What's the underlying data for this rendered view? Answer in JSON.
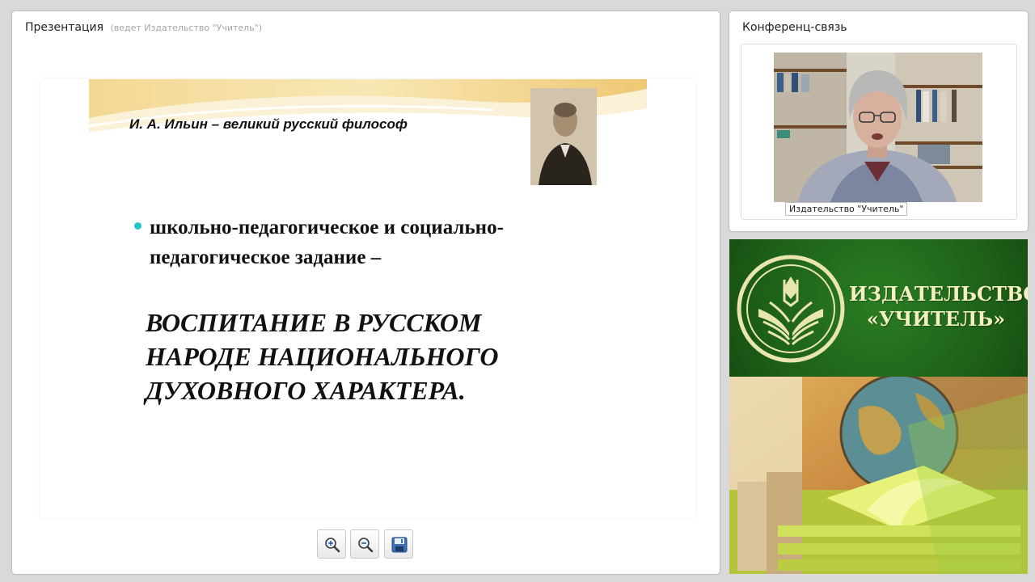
{
  "presentation": {
    "title": "Презентация",
    "subtitle": "(ведет Издательство \"Учитель\")",
    "slide": {
      "banner_title": "И. А. Ильин – великий русский философ",
      "bullet_line_1": "школьно-педагогическое и социально-",
      "bullet_line_2": "педагогическое задание –",
      "emphasis_line_1": "ВОСПИТАНИЕ В РУССКОМ",
      "emphasis_line_2": "НАРОДЕ НАЦИОНАЛЬНОГО",
      "emphasis_line_3": "ДУХОВНОГО ХАРАКТЕРА.",
      "bullet_color": "#22c7c8"
    },
    "toolbar": [
      {
        "icon": "zoom-in-icon"
      },
      {
        "icon": "zoom-out-icon"
      },
      {
        "icon": "save-icon"
      }
    ]
  },
  "conference": {
    "title": "Конференц-связь",
    "video_caption": "Издательство \"Учитель\""
  },
  "publisher": {
    "name_line_1": "ИЗДАТЕЛЬСТВО",
    "name_line_2": "«УЧИТЕЛЬ»",
    "colors": {
      "green": "#1f6a1d",
      "text": "#f3f0c2"
    }
  }
}
